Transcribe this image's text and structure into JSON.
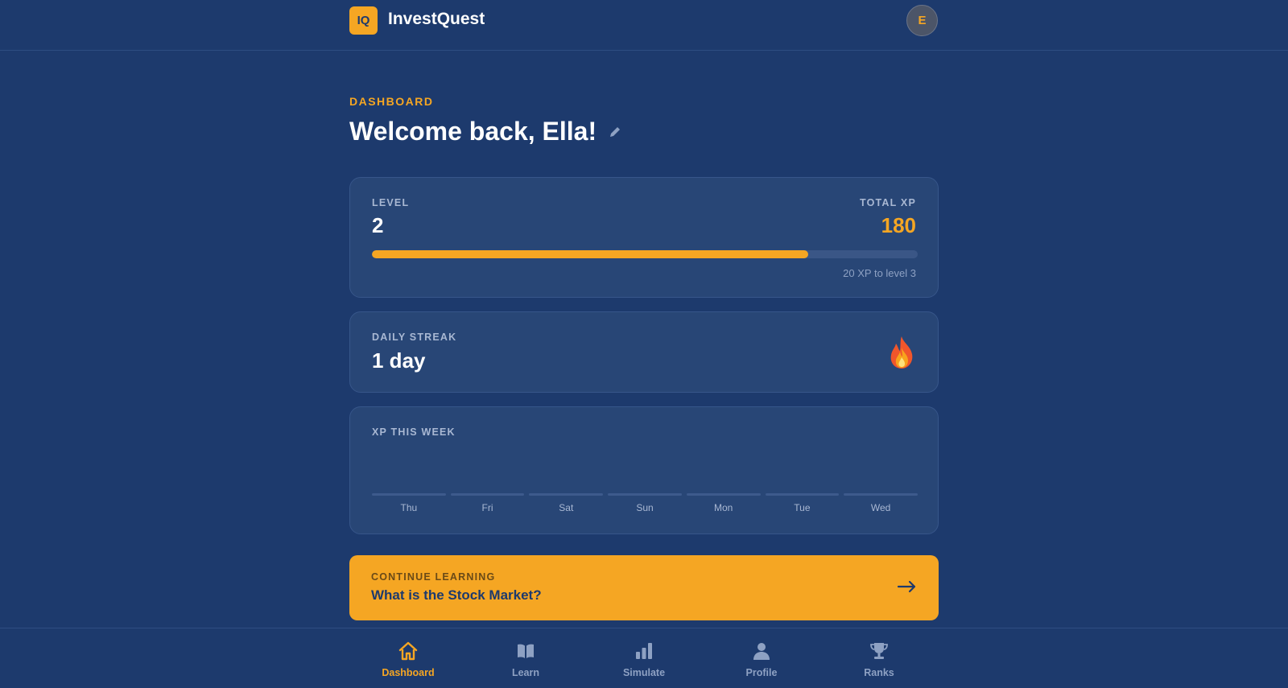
{
  "app": {
    "logo_text": "IQ",
    "name": "InvestQuest"
  },
  "user": {
    "avatar_initial": "E"
  },
  "page": {
    "eyebrow": "DASHBOARD",
    "welcome": "Welcome back, Ella!"
  },
  "level_card": {
    "level_label": "LEVEL",
    "level_value": "2",
    "xp_label": "TOTAL XP",
    "xp_value": "180",
    "progress_fraction": 0.8,
    "progress_note": "20 XP to level 3"
  },
  "streak_card": {
    "label": "DAILY STREAK",
    "value": "1 day",
    "icon": "fire-icon"
  },
  "week_card": {
    "label": "XP THIS WEEK",
    "days": [
      "Thu",
      "Fri",
      "Sat",
      "Sun",
      "Mon",
      "Tue",
      "Wed"
    ],
    "xp_values": [
      0,
      0,
      0,
      0,
      0,
      0,
      0
    ]
  },
  "continue_card": {
    "label": "CONTINUE LEARNING",
    "title": "What is the Stock Market?",
    "icon": "arrow-right-icon"
  },
  "nav": {
    "items": [
      {
        "label": "Dashboard",
        "icon": "home-icon",
        "active": true
      },
      {
        "label": "Learn",
        "icon": "book-icon",
        "active": false
      },
      {
        "label": "Simulate",
        "icon": "bar-chart-icon",
        "active": false
      },
      {
        "label": "Profile",
        "icon": "person-icon",
        "active": false
      },
      {
        "label": "Ranks",
        "icon": "trophy-icon",
        "active": false
      }
    ]
  },
  "colors": {
    "background": "#1d3a6d",
    "card": "#284676",
    "accent": "#f5a623",
    "muted_text": "#a9b8d3"
  }
}
